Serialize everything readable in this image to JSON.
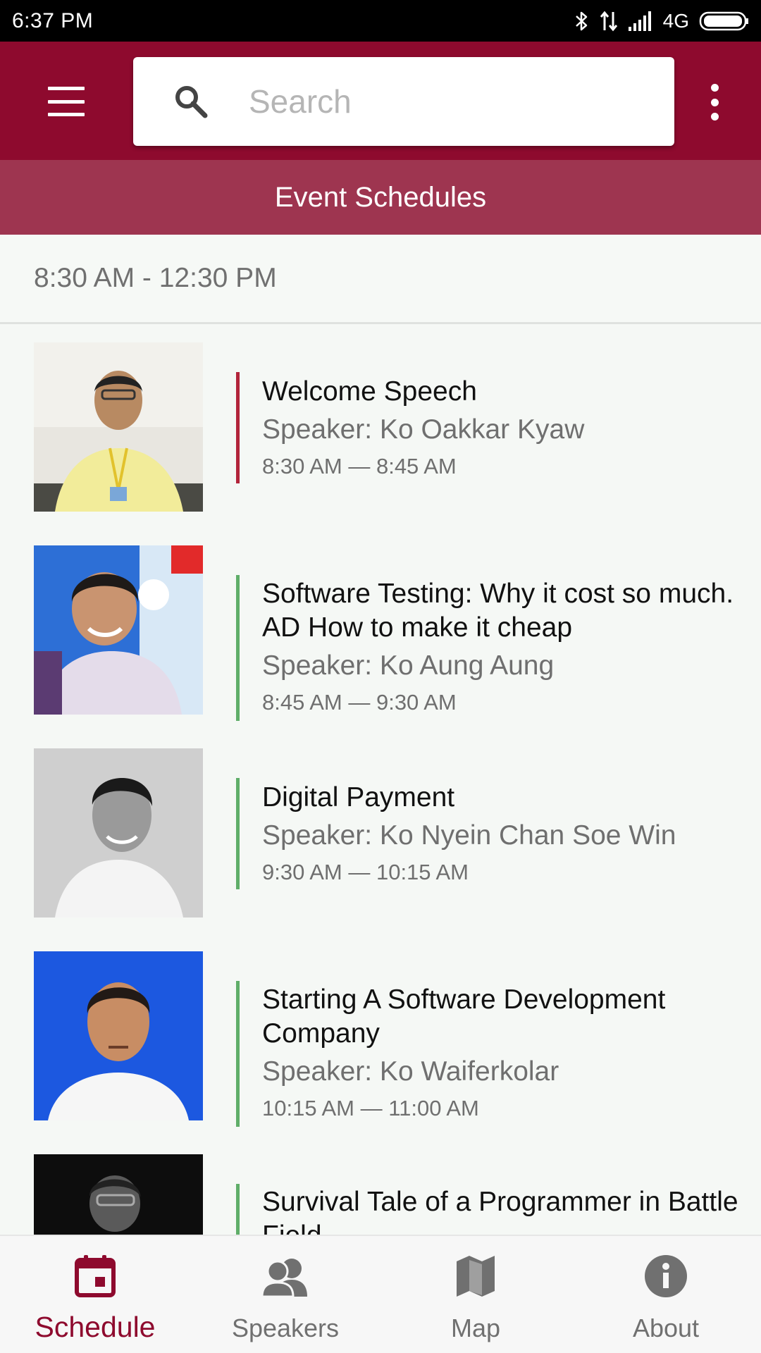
{
  "status_bar": {
    "time": "6:37 PM",
    "network": "4G",
    "icons": [
      "bluetooth-icon",
      "data-arrows-icon",
      "signal-icon",
      "battery-icon"
    ]
  },
  "app_bar": {
    "search_placeholder": "Search",
    "menu_icon": "hamburger-menu-icon",
    "overflow_icon": "more-vert-icon",
    "color": "#8e0a2e"
  },
  "section": {
    "title": "Event Schedules"
  },
  "time_slot": "8:30 AM - 12:30 PM",
  "sessions": [
    {
      "title": "Welcome Speech",
      "speaker": "Speaker: Ko Oakkar Kyaw",
      "time": "8:30 AM — 8:45 AM",
      "accent": "#b2243a"
    },
    {
      "title": "Software Testing: Why it cost so much. AD How to make it cheap",
      "speaker": "Speaker: Ko Aung Aung",
      "time": "8:45 AM — 9:30 AM",
      "accent": "#5fae69"
    },
    {
      "title": "Digital Payment",
      "speaker": "Speaker: Ko Nyein Chan Soe Win",
      "time": "9:30 AM — 10:15 AM",
      "accent": "#5fae69"
    },
    {
      "title": "Starting A Software Development Company",
      "speaker": "Speaker: Ko Waiferkolar",
      "time": "10:15 AM — 11:00 AM",
      "accent": "#5fae69"
    },
    {
      "title": "Survival Tale of a Programmer in Battle Field",
      "speaker": "",
      "time": "",
      "accent": "#5fae69"
    }
  ],
  "bottom_nav": {
    "items": [
      {
        "label": "Schedule",
        "icon": "calendar-icon",
        "active": true
      },
      {
        "label": "Speakers",
        "icon": "people-icon",
        "active": false
      },
      {
        "label": "Map",
        "icon": "map-icon",
        "active": false
      },
      {
        "label": "About",
        "icon": "info-icon",
        "active": false
      }
    ],
    "active_color": "#8e0a2e",
    "inactive_color": "#707070"
  }
}
